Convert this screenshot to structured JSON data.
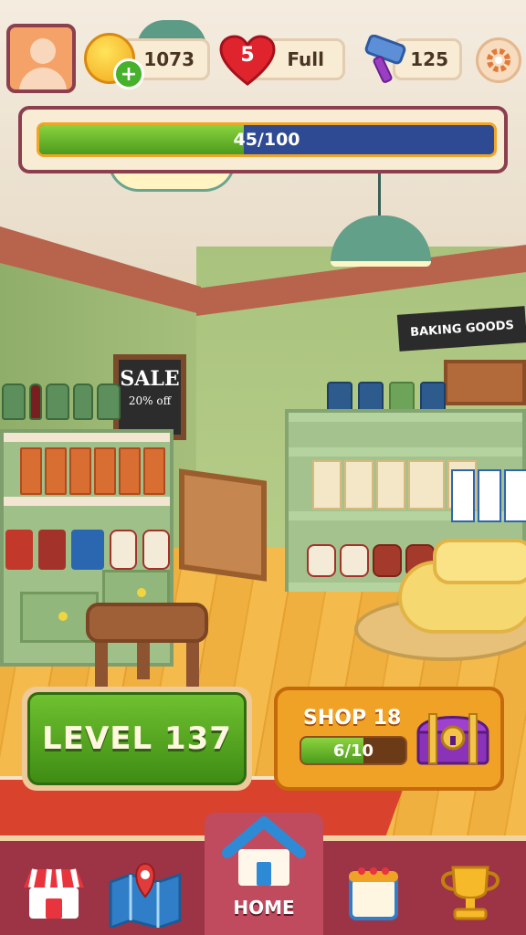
{
  "hud": {
    "coins": "1073",
    "lives": "5",
    "lives_status": "Full",
    "hammers": "125"
  },
  "progress": {
    "label": "45/100",
    "fraction": 0.45
  },
  "scene": {
    "sign_text": "BAKING GOODS",
    "chalk_big": "SALE",
    "chalk_small": "20% off"
  },
  "level_button": {
    "label": "LEVEL 137"
  },
  "shop_button": {
    "title": "SHOP 18",
    "progress_label": "6/10",
    "fraction": 0.6
  },
  "nav": {
    "items": [
      {
        "name": "shop",
        "icon": "store-icon"
      },
      {
        "name": "map",
        "icon": "map-icon"
      },
      {
        "name": "home",
        "icon": "home-icon",
        "label": "HOME"
      },
      {
        "name": "calendar",
        "icon": "calendar-icon"
      },
      {
        "name": "leaderboard",
        "icon": "trophy-icon"
      }
    ]
  },
  "colors": {
    "accent_maroon": "#8b3f4f",
    "progress_green": "#5cae26",
    "progress_blue": "#2e4a93",
    "nav_bg": "#9d3446"
  }
}
